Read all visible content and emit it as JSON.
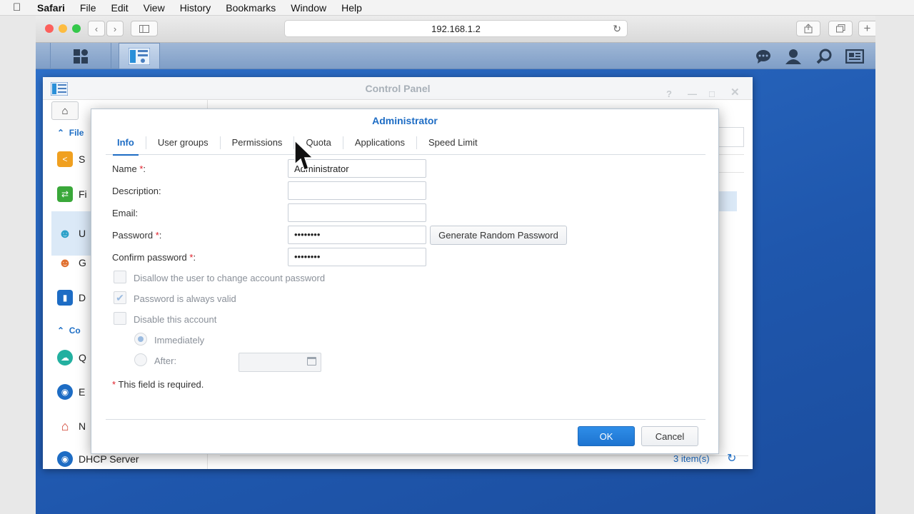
{
  "menubar": {
    "items": [
      "Safari",
      "File",
      "Edit",
      "View",
      "History",
      "Bookmarks",
      "Window",
      "Help"
    ]
  },
  "browser": {
    "url": "192.168.1.2",
    "icons": [
      "back-icon",
      "forward-icon",
      "sidebar-icon",
      "reload-icon",
      "share-icon",
      "tabs-icon",
      "new-tab-icon"
    ]
  },
  "dsm": {
    "taskbar_icons": [
      "main-menu-icon",
      "control-panel-icon",
      "notification-icon",
      "user-icon",
      "search-icon",
      "widgets-icon"
    ]
  },
  "control_panel": {
    "title": "Control Panel",
    "sidebar": {
      "section1": "File",
      "section2": "Co",
      "items": [
        {
          "label": "S",
          "icon": "shared-folder-icon",
          "color": "#f0a020"
        },
        {
          "label": "Fi",
          "icon": "file-services-icon",
          "color": "#3aa83a"
        },
        {
          "label": "U",
          "icon": "user-icon",
          "color": "#2aa0c8"
        },
        {
          "label": "G",
          "icon": "group-icon",
          "color": "#e07030"
        },
        {
          "label": "D",
          "icon": "domain-icon",
          "color": "#1d6cc4"
        },
        {
          "label": "Q",
          "icon": "quickconnect-icon",
          "color": "#23b0a0"
        },
        {
          "label": "E",
          "icon": "external-access-icon",
          "color": "#1d6cc4"
        },
        {
          "label": "N",
          "icon": "network-icon",
          "color": "#d04030"
        },
        {
          "label": "DHCP Server",
          "icon": "dhcp-server-icon",
          "color": "#1d6cc4"
        }
      ]
    },
    "footer": {
      "count": "3 item(s)"
    }
  },
  "dialog": {
    "title": "Administrator",
    "tabs": [
      "Info",
      "User groups",
      "Permissions",
      "Quota",
      "Applications",
      "Speed Limit"
    ],
    "fields": {
      "name_label": "Name",
      "name_value": "Administrator",
      "description_label": "Description:",
      "description_value": "",
      "email_label": "Email:",
      "email_value": "",
      "password_label": "Password",
      "password_value": "••••••••",
      "confirm_label": "Confirm password",
      "confirm_value": "••••••••",
      "required_suffix": "*",
      "colon": ":"
    },
    "generate_button": "Generate Random Password",
    "checkboxes": {
      "disallow": "Disallow the user to change account password",
      "always_valid": "Password is always valid",
      "disable": "Disable this account"
    },
    "radios": {
      "immediately": "Immediately",
      "after": "After:"
    },
    "required_note": "This field is required.",
    "ok": "OK",
    "cancel": "Cancel"
  }
}
